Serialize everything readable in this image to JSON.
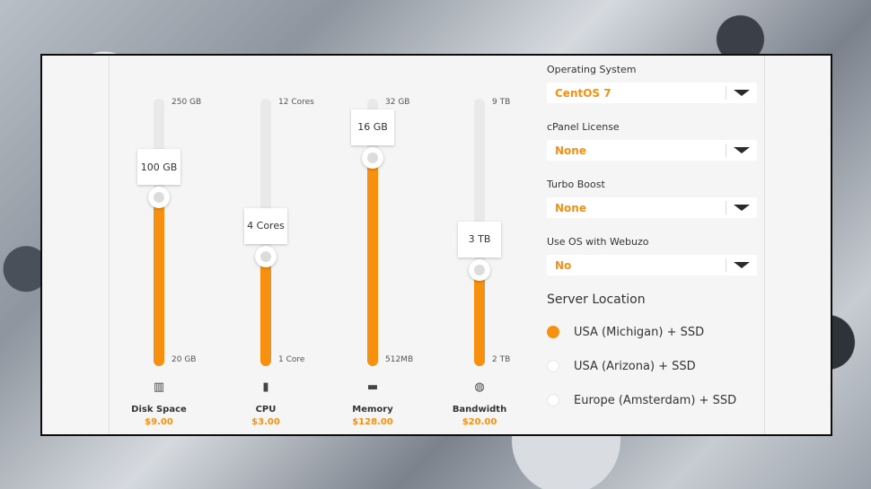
{
  "sliders": [
    {
      "name": "Disk Space",
      "price": "$9.00",
      "max": "250 GB",
      "min": "20 GB",
      "current": "100 GB",
      "fraction": 0.63,
      "icon": "hard-drive-icon",
      "glyph": "▥"
    },
    {
      "name": "CPU",
      "price": "$3.00",
      "max": "12 Cores",
      "min": "1 Core",
      "current": "4 Cores",
      "fraction": 0.41,
      "icon": "cpu-icon",
      "glyph": "▮"
    },
    {
      "name": "Memory",
      "price": "$128.00",
      "max": "32 GB",
      "min": "512MB",
      "current": "16 GB",
      "fraction": 0.78,
      "icon": "memory-icon",
      "glyph": "▬"
    },
    {
      "name": "Bandwidth",
      "price": "$20.00",
      "max": "9 TB",
      "min": "2 TB",
      "current": "3 TB",
      "fraction": 0.36,
      "icon": "bandwidth-icon",
      "glyph": "◍"
    }
  ],
  "options": [
    {
      "label": "Operating System",
      "value": "CentOS 7"
    },
    {
      "label": "cPanel License",
      "value": "None"
    },
    {
      "label": "Turbo Boost",
      "value": "None"
    },
    {
      "label": "Use OS with Webuzo",
      "value": "No"
    }
  ],
  "location": {
    "title": "Server Location",
    "choices": [
      {
        "label": "USA (Michigan) + SSD",
        "checked": true
      },
      {
        "label": "USA (Arizona) + SSD",
        "checked": false
      },
      {
        "label": "Europe (Amsterdam) + SSD",
        "checked": false
      }
    ]
  },
  "colors": {
    "accent": "#f7900f",
    "track": "#e9e9e9",
    "panel": "#f5f5f5"
  }
}
